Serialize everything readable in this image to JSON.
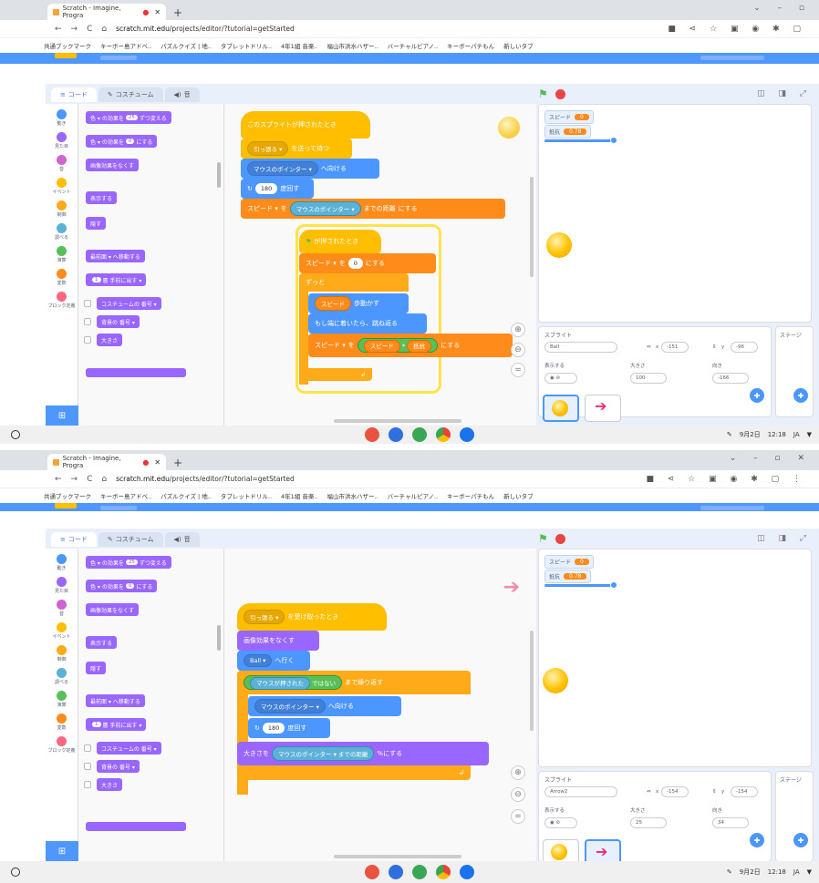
{
  "browser": {
    "tab_title": "Scratch - Imagine, Progra",
    "tab_title_2": "Scratch - Imagine, Progra",
    "url_host": "scratch.mit.edu",
    "url_path": "/projects/editor/?tutorial=getStarted",
    "bookmarks": [
      "共通ブックマーク",
      "キーボー島アドベ..",
      "パズルクイズ | 地..",
      "タブレットドリル..",
      "4年1組 音楽..",
      "福山市洪水ハザー..",
      "バーチャルピアノ..",
      "キーボーパチもん",
      "新しいタブ"
    ]
  },
  "editor": {
    "tabs": [
      "コード",
      "コスチューム",
      "音"
    ],
    "tabs_2": [
      "コード",
      "コスチューム",
      "音"
    ],
    "categories": [
      {
        "label": "動き",
        "color": "#4c97ff"
      },
      {
        "label": "見た目",
        "color": "#9966ff"
      },
      {
        "label": "音",
        "color": "#cf63cf"
      },
      {
        "label": "イベント",
        "color": "#ffbf00"
      },
      {
        "label": "制御",
        "color": "#ffab19"
      },
      {
        "label": "調べる",
        "color": "#5cb1d6"
      },
      {
        "label": "演算",
        "color": "#59c059"
      },
      {
        "label": "変数",
        "color": "#ff8c1a"
      },
      {
        "label": "ブロック定義",
        "color": "#ff6680"
      }
    ]
  },
  "palette1": {
    "b1": "色 ▾ の効果を",
    "b1v": "25",
    "b1e": "ずつ変える",
    "b2": "色 ▾ の効果を",
    "b2v": "0",
    "b2e": "にする",
    "b3": "画像効果をなくす",
    "b4": "表示する",
    "b5": "隠す",
    "b6": "最前面 ▾ へ移動する",
    "b7v": "1",
    "b7": "層 手前に出す ▾",
    "b8": "コスチュームの 番号 ▾",
    "b9": "背景の 番号 ▾",
    "b10": "大きさ"
  },
  "palette2": {
    "b1": "色 ▾ の効果を",
    "b1v": "25",
    "b1e": "ずつ変える",
    "b2": "色 ▾ の効果を",
    "b2v": "0",
    "b2e": "にする",
    "b3": "画像効果をなくす",
    "b4": "表示する",
    "b5": "隠す",
    "b6": "最前面 ▾ へ移動する",
    "b7v": "1",
    "b7": "層 手前に出す ▾",
    "b8": "コスチュームの 番号 ▾",
    "b9": "背景の 番号 ▾",
    "b10": "大きさ"
  },
  "script1": {
    "hat": "このスプライトが押されたとき",
    "send": "引っ張る ▾",
    "send_end": "を送って待つ",
    "point": "マウスのポインター ▾",
    "point_end": "へ向ける",
    "turn_v": "180",
    "turn": "度回す",
    "setvar": "スピード ▾",
    "setvar_to": "を",
    "dist": "マウスのポインター ▾",
    "dist_end": "までの距離",
    "setvar_end": "にする",
    "flaghat": "が押されたとき",
    "set0": "スピード ▾",
    "set0_to": "を",
    "set0_v": "0",
    "set0_end": "にする",
    "forever": "ずっと",
    "move_v": "スピード",
    "move": "歩動かす",
    "bounce": "もし端に着いたら、跳ね返る",
    "set_sp": "スピード ▾",
    "set_sp_to": "を",
    "mul_a": "スピード",
    "mul_b": "抵抗",
    "set_sp_end": "にする"
  },
  "script2": {
    "hat": "引っ張る ▾",
    "hat_end": "を受け取ったとき",
    "clear": "画像効果をなくす",
    "goto": "Ball ▾",
    "goto_end": "へ行く",
    "repeat_cond": "マウスが押された",
    "not": "ではない",
    "repeat_end": "まで繰り返す",
    "point": "マウスのポインター ▾",
    "point_end": "へ向ける",
    "turn_v": "180",
    "turn": "度回す",
    "size": "大きさを",
    "size_dist": "マウスのポインター ▾",
    "size_dist_end": "までの距離",
    "size_end": "%にする"
  },
  "stage1": {
    "mon1_name": "スピード",
    "mon1_val": "0",
    "mon2_name": "抵抗",
    "mon2_val": "0.78",
    "sprite_label": "スプライト",
    "sprite_name": "Ball",
    "x_label": "x",
    "x_val": "-151",
    "y_label": "y",
    "y_val": "-96",
    "show_label": "表示する",
    "size_label": "大きさ",
    "size_val": "100",
    "dir_label": "向き",
    "dir_val": "-166",
    "stage_label": "ステージ"
  },
  "stage2": {
    "mon1_name": "スピード",
    "mon1_val": "0",
    "mon2_name": "抵抗",
    "mon2_val": "0.78",
    "sprite_label": "スプライト",
    "sprite_name": "Arrow2",
    "x_label": "x",
    "x_val": "-154",
    "y_label": "y",
    "y_val": "-154",
    "show_label": "表示する",
    "size_label": "大きさ",
    "size_val": "25",
    "dir_label": "向き",
    "dir_val": "34",
    "stage_label": "ステージ"
  },
  "shelf": {
    "date": "9月2日",
    "time": "12:18",
    "lang": "JA",
    "date_2": "9月2日",
    "time_2": "12:18",
    "lang_2": "JA"
  }
}
